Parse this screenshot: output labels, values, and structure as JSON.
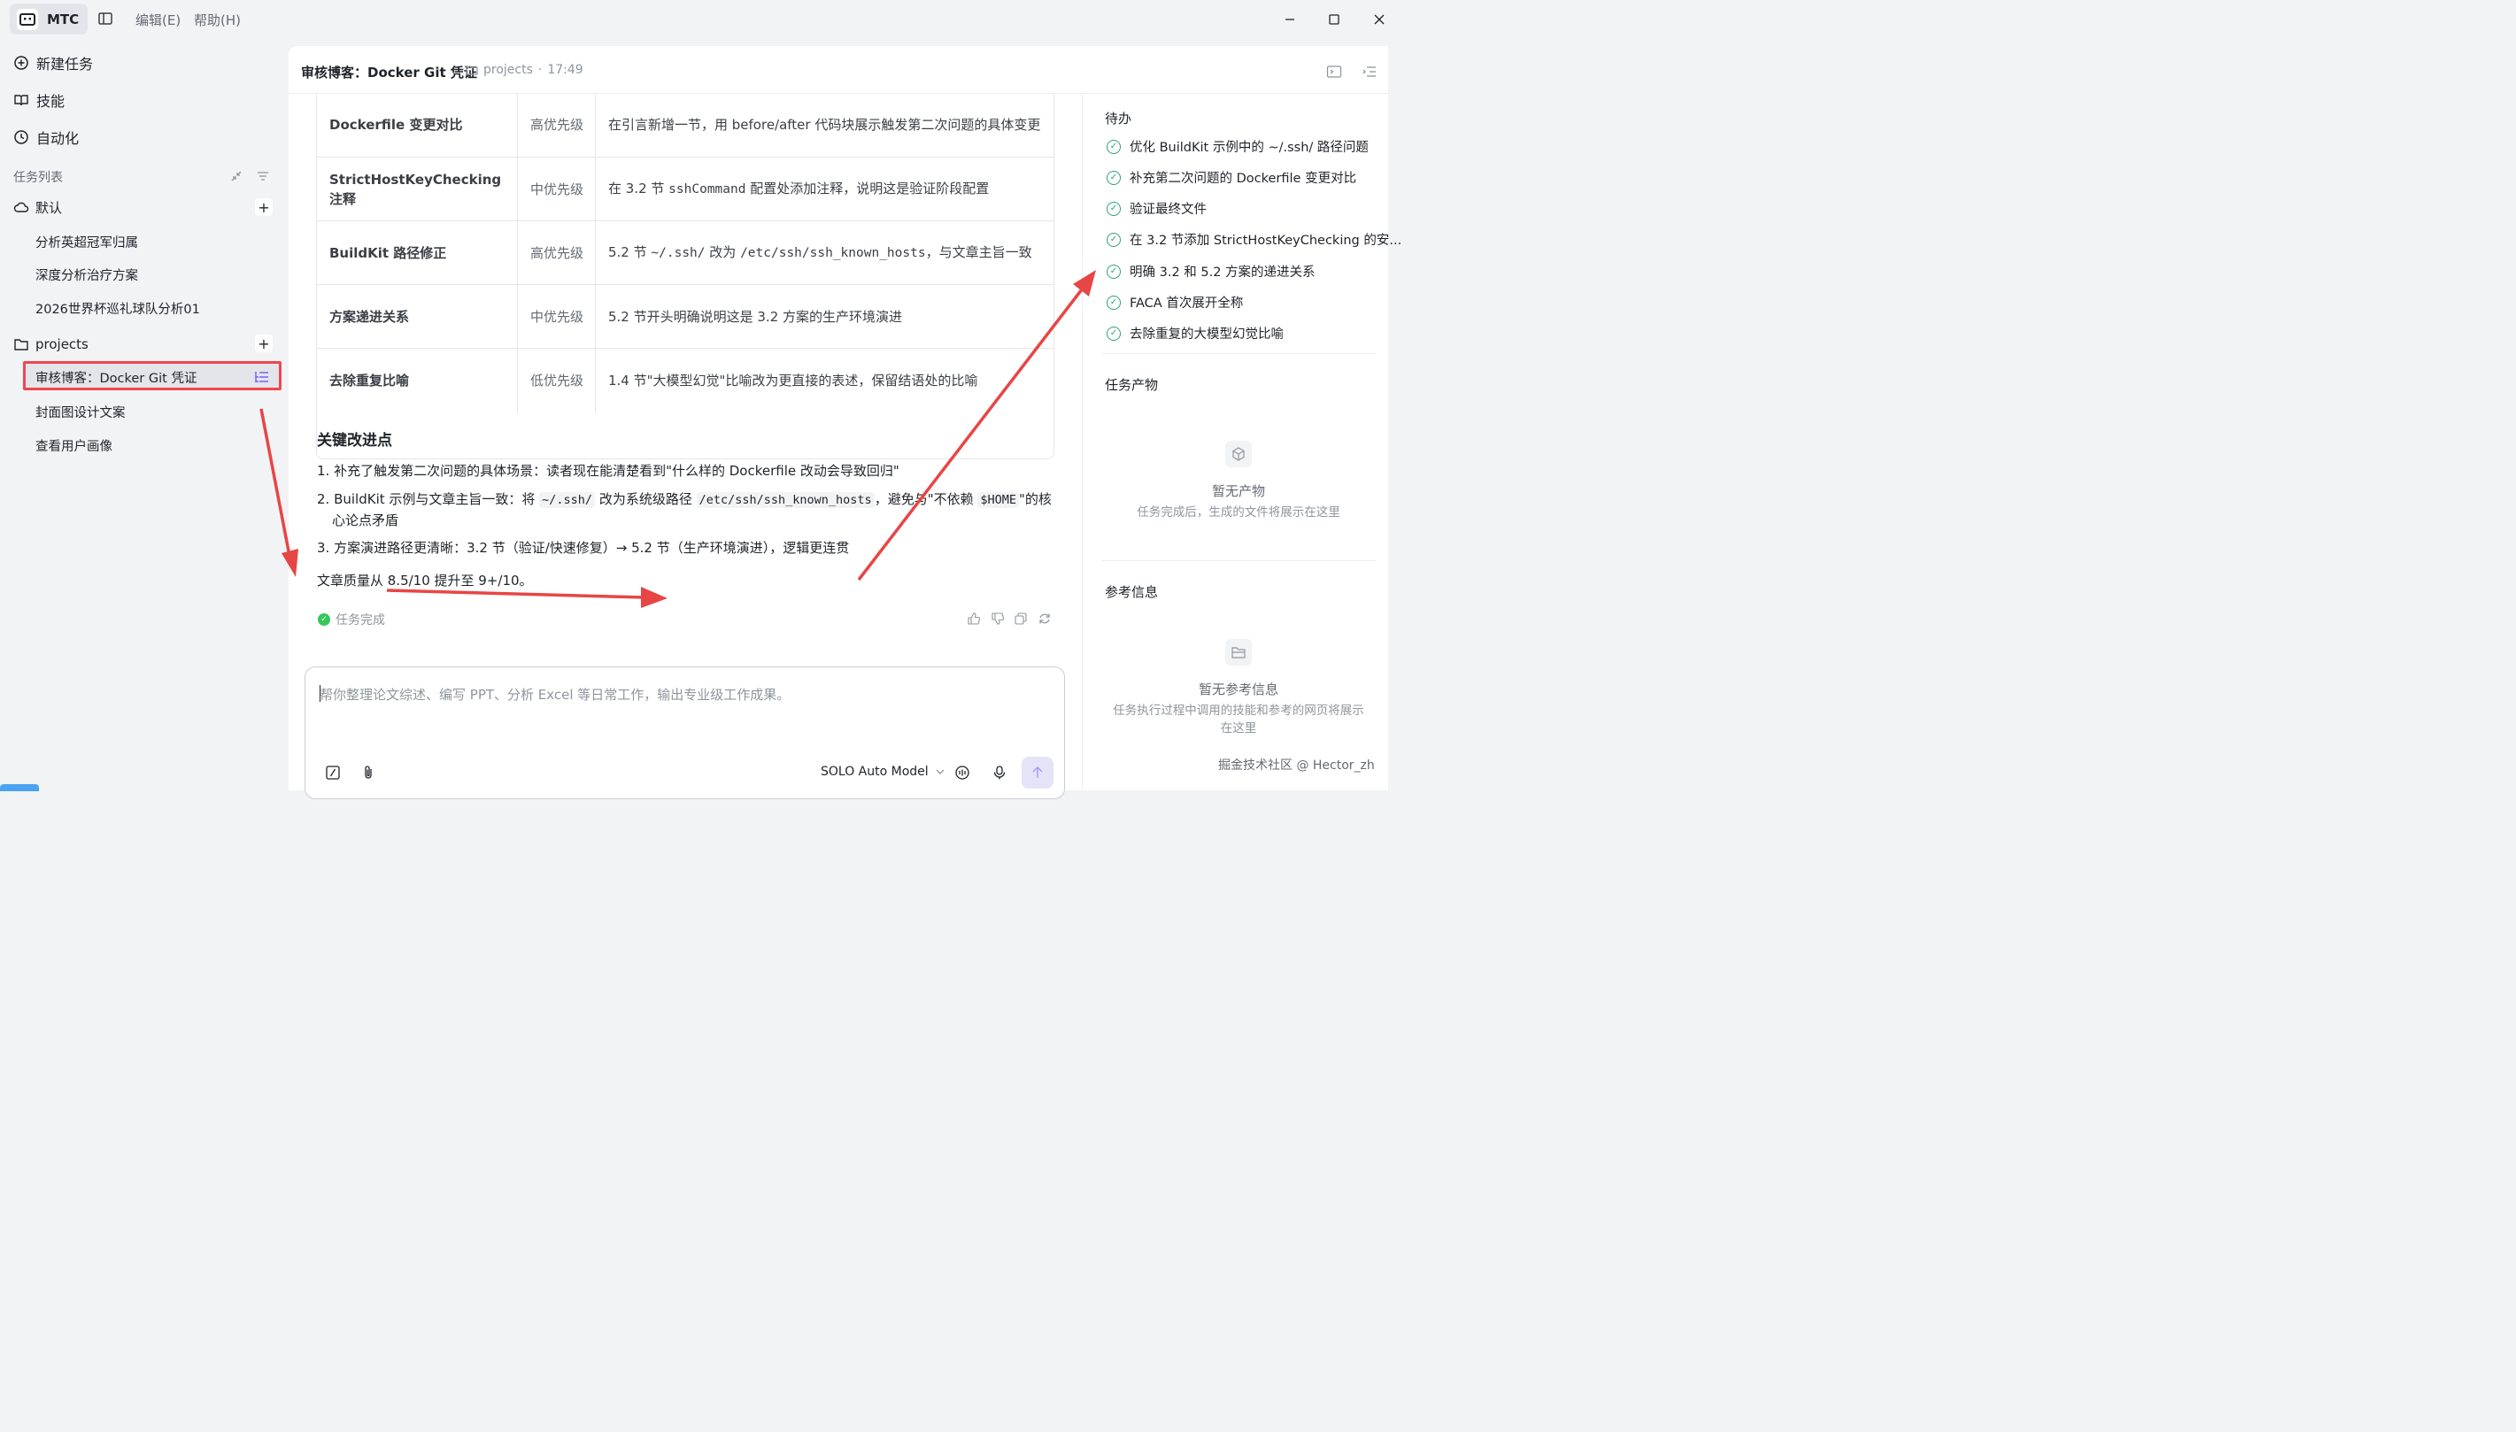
{
  "app": {
    "name": "MTC"
  },
  "menu": {
    "edit": "编辑(E)",
    "help": "帮助(H)"
  },
  "sidebar": {
    "new_task": "新建任务",
    "skills": "技能",
    "automation": "自动化",
    "task_list_title": "任务列表",
    "groups": [
      {
        "name": "默认",
        "items": [
          "分析英超冠军归属",
          "深度分析治疗方案",
          "2026世界杯巡礼球队分析01"
        ]
      },
      {
        "name": "projects",
        "items": [
          "审核博客：Docker Git 凭证",
          "封面图设计文案",
          "查看用户画像"
        ]
      }
    ]
  },
  "header": {
    "title": "审核博客：Docker Git 凭证",
    "folder": "projects",
    "time": "17:49"
  },
  "table": {
    "rows": [
      {
        "item": "Dockerfile 变更对比",
        "priority": "高优先级",
        "desc": "在引言新增一节，用 before/after 代码块展示触发第二次问题的具体变更"
      },
      {
        "item": "StrictHostKeyChecking 注释",
        "priority": "中优先级",
        "desc_pre": "在 3.2 节 ",
        "desc_code": "sshCommand",
        "desc_post": " 配置处添加注释，说明这是验证阶段配置"
      },
      {
        "item": "BuildKit 路径修正",
        "priority": "高优先级",
        "desc_pre": "5.2 节 ",
        "desc_code": "~/.ssh/",
        "desc_mid": " 改为 ",
        "desc_code2": "/etc/ssh/ssh_known_hosts",
        "desc_post": "，与文章主旨一致"
      },
      {
        "item": "方案递进关系",
        "priority": "中优先级",
        "desc": "5.2 节开头明确说明这是 3.2 方案的生产环境演进"
      },
      {
        "item": "去除重复比喻",
        "priority": "低优先级",
        "desc": "1.4 节\"大模型幻觉\"比喻改为更直接的表述，保留结语处的比喻"
      }
    ]
  },
  "content": {
    "heading": "关键改进点",
    "points": {
      "p1": "1. 补充了触发第二次问题的具体场景：读者现在能清楚看到\"什么样的 Dockerfile 改动会导致回归\"",
      "p2_pre": "2. BuildKit 示例与文章主旨一致：将 ",
      "p2_code1": "~/.ssh/",
      "p2_mid": " 改为系统级路径 ",
      "p2_code2": "/etc/ssh/ssh_known_hosts",
      "p2_mid2": "，避免与\"不依赖 ",
      "p2_code3": "$HOME",
      "p2_post": "\"的核心论点矛盾",
      "p3": "3. 方案演进路径更清晰：3.2 节（验证/快速修复）→ 5.2 节（生产环境演进），逻辑更连贯"
    },
    "summary": "文章质量从 8.5/10 提升至 9+/10。",
    "status": "任务完成"
  },
  "input": {
    "placeholder": "帮你整理论文综述、编写 PPT、分析 Excel 等日常工作，输出专业级工作成果。",
    "model": "SOLO Auto Model"
  },
  "right_panel": {
    "todo_title": "待办",
    "todos": [
      "优化 BuildKit 示例中的 ~/.ssh/ 路径问题",
      "补充第二次问题的 Dockerfile 变更对比",
      "验证最终文件",
      "在 3.2 节添加 StrictHostKeyChecking 的安...",
      "明确 3.2 和 5.2 方案的递进关系",
      "FACA 首次展开全称",
      "去除重复的大模型幻觉比喻"
    ],
    "artifacts_title": "任务产物",
    "artifacts_empty_title": "暂无产物",
    "artifacts_empty_desc": "任务完成后，生成的文件将展示在这里",
    "refs_title": "参考信息",
    "refs_empty_title": "暂无参考信息",
    "refs_empty_desc_1": "任务执行过程中调用的技能和参考的网页将展示",
    "refs_empty_desc_2": "在这里"
  },
  "watermark": "掘金技术社区 @ Hector_zh",
  "colors": {
    "highlight_border": "#f0464e",
    "annotation_arrow": "#e84545",
    "check_green": "#2ba471",
    "status_green": "#34c759"
  }
}
